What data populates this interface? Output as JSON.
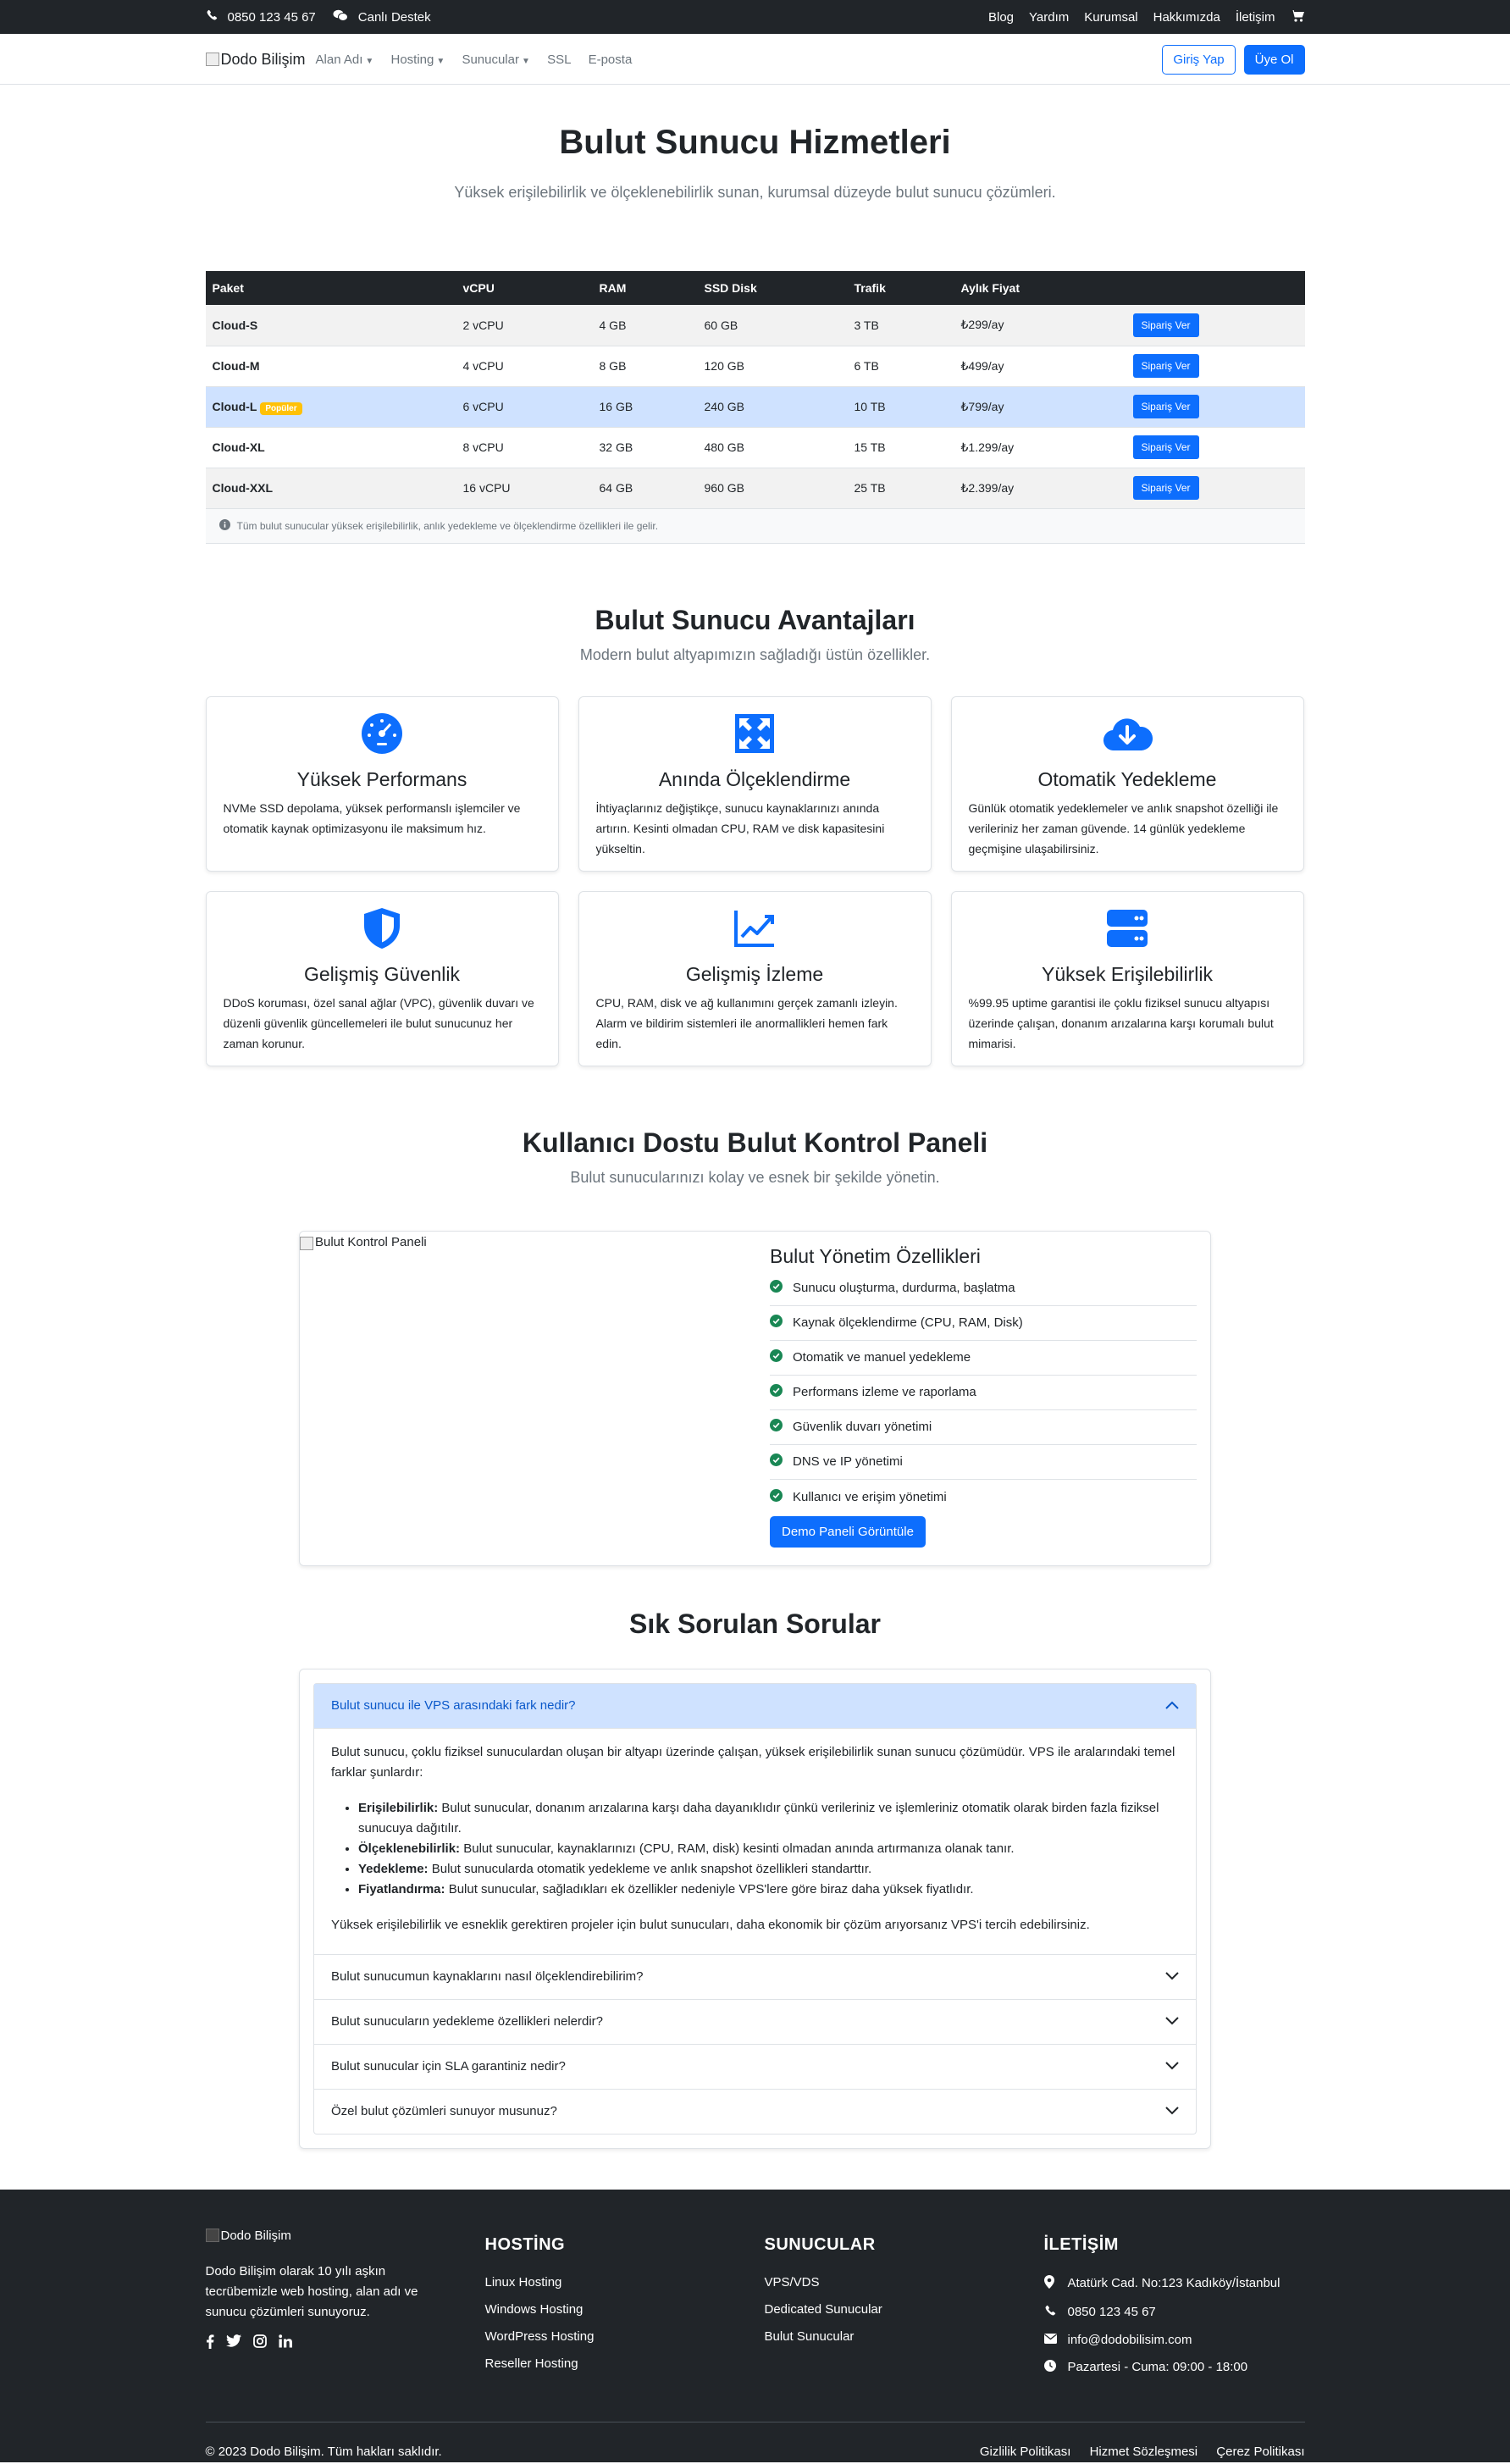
{
  "topbar": {
    "phone": "0850 123 45 67",
    "live_support": "Canlı Destek",
    "links": [
      "Blog",
      "Yardım",
      "Kurumsal",
      "Hakkımızda",
      "İletişim"
    ]
  },
  "navbar": {
    "brand": "Dodo Bilişim",
    "menu": [
      {
        "label": "Alan Adı",
        "dropdown": true
      },
      {
        "label": "Hosting",
        "dropdown": true
      },
      {
        "label": "Sunucular",
        "dropdown": true
      },
      {
        "label": "SSL",
        "dropdown": false
      },
      {
        "label": "E-posta",
        "dropdown": false
      }
    ],
    "login": "Giriş Yap",
    "signup": "Üye Ol"
  },
  "hero": {
    "title": "Bulut Sunucu Hizmetleri",
    "subtitle": "Yüksek erişilebilirlik ve ölçeklenebilirlik sunan, kurumsal düzeyde bulut sunucu çözümleri."
  },
  "pricing": {
    "headers": [
      "Paket",
      "vCPU",
      "RAM",
      "SSD Disk",
      "Trafik",
      "Aylık Fiyat",
      ""
    ],
    "order_label": "Sipariş Ver",
    "popular_badge": "Popüler",
    "rows": [
      {
        "name": "Cloud-S",
        "vcpu": "2 vCPU",
        "ram": "4 GB",
        "disk": "60 GB",
        "traffic": "3 TB",
        "price": "₺299/ay"
      },
      {
        "name": "Cloud-M",
        "vcpu": "4 vCPU",
        "ram": "8 GB",
        "disk": "120 GB",
        "traffic": "6 TB",
        "price": "₺499/ay"
      },
      {
        "name": "Cloud-L",
        "vcpu": "6 vCPU",
        "ram": "16 GB",
        "disk": "240 GB",
        "traffic": "10 TB",
        "price": "₺799/ay"
      },
      {
        "name": "Cloud-XL",
        "vcpu": "8 vCPU",
        "ram": "32 GB",
        "disk": "480 GB",
        "traffic": "15 TB",
        "price": "₺1.299/ay"
      },
      {
        "name": "Cloud-XXL",
        "vcpu": "16 vCPU",
        "ram": "64 GB",
        "disk": "960 GB",
        "traffic": "25 TB",
        "price": "₺2.399/ay"
      }
    ],
    "note": "Tüm bulut sunucular yüksek erişilebilirlik, anlık yedekleme ve ölçeklendirme özellikleri ile gelir."
  },
  "advantages": {
    "title": "Bulut Sunucu Avantajları",
    "subtitle": "Modern bulut altyapımızın sağladığı üstün özellikler.",
    "cards": [
      {
        "icon": "speedometer-icon",
        "title": "Yüksek Performans",
        "text": "NVMe SSD depolama, yüksek performanslı işlemciler ve otomatik kaynak optimizasyonu ile maksimum hız."
      },
      {
        "icon": "arrows-expand-icon",
        "title": "Anında Ölçeklendirme",
        "text": "İhtiyaçlarınız değiştikçe, sunucu kaynaklarınızı anında artırın. Kesinti olmadan CPU, RAM ve disk kapasitesini yükseltin."
      },
      {
        "icon": "cloud-download-icon",
        "title": "Otomatik Yedekleme",
        "text": "Günlük otomatik yedeklemeler ve anlık snapshot özelliği ile verileriniz her zaman güvende. 14 günlük yedekleme geçmişine ulaşabilirsiniz."
      },
      {
        "icon": "shield-icon",
        "title": "Gelişmiş Güvenlik",
        "text": "DDoS koruması, özel sanal ağlar (VPC), güvenlik duvarı ve düzenli güvenlik güncellemeleri ile bulut sunucunuz her zaman korunur."
      },
      {
        "icon": "chart-line-icon",
        "title": "Gelişmiş İzleme",
        "text": "CPU, RAM, disk ve ağ kullanımını gerçek zamanlı izleyin. Alarm ve bildirim sistemleri ile anormallikleri hemen fark edin."
      },
      {
        "icon": "server-icon",
        "title": "Yüksek Erişilebilirlik",
        "text": "%99.95 uptime garantisi ile çoklu fiziksel sunucu altyapısı üzerinde çalışan, donanım arızalarına karşı korumalı bulut mimarisi."
      }
    ]
  },
  "control_panel": {
    "title": "Kullanıcı Dostu Bulut Kontrol Paneli",
    "subtitle": "Bulut sunucularınızı kolay ve esnek bir şekilde yönetin.",
    "image_alt": "Bulut Kontrol Paneli",
    "features_title": "Bulut Yönetim Özellikleri",
    "features": [
      "Sunucu oluşturma, durdurma, başlatma",
      "Kaynak ölçeklendirme (CPU, RAM, Disk)",
      "Otomatik ve manuel yedekleme",
      "Performans izleme ve raporlama",
      "Güvenlik duvarı yönetimi",
      "DNS ve IP yönetimi",
      "Kullanıcı ve erişim yönetimi"
    ],
    "demo_button": "Demo Paneli Görüntüle"
  },
  "faq": {
    "title": "Sık Sorulan Sorular",
    "open_question": "Bulut sunucu ile VPS arasındaki fark nedir?",
    "open_intro": "Bulut sunucu, çoklu fiziksel sunuculardan oluşan bir altyapı üzerinde çalışan, yüksek erişilebilirlik sunan sunucu çözümüdür. VPS ile aralarındaki temel farklar şunlardır:",
    "open_points": [
      {
        "term": "Erişilebilirlik:",
        "text": " Bulut sunucular, donanım arızalarına karşı daha dayanıklıdır çünkü verileriniz ve işlemleriniz otomatik olarak birden fazla fiziksel sunucuya dağıtılır."
      },
      {
        "term": "Ölçeklenebilirlik:",
        "text": " Bulut sunucular, kaynaklarınızı (CPU, RAM, disk) kesinti olmadan anında artırmanıza olanak tanır."
      },
      {
        "term": "Yedekleme:",
        "text": " Bulut sunucularda otomatik yedekleme ve anlık snapshot özellikleri standarttır."
      },
      {
        "term": "Fiyatlandırma:",
        "text": " Bulut sunucular, sağladıkları ek özellikler nedeniyle VPS'lere göre biraz daha yüksek fiyatlıdır."
      }
    ],
    "open_outro": "Yüksek erişilebilirlik ve esneklik gerektiren projeler için bulut sunucuları, daha ekonomik bir çözüm arıyorsanız VPS'i tercih edebilirsiniz.",
    "closed_questions": [
      "Bulut sunucumun kaynaklarını nasıl ölçeklendirebilirim?",
      "Bulut sunucuların yedekleme özellikleri nelerdir?",
      "Bulut sunucular için SLA garantiniz nedir?",
      "Özel bulut çözümleri sunuyor musunuz?"
    ]
  },
  "footer": {
    "brand": "Dodo Bilişim",
    "about": "Dodo Bilişim olarak 10 yılı aşkın tecrübemizle web hosting, alan adı ve sunucu çözümleri sunuyoruz.",
    "hosting_title": "HOSTİNG",
    "hosting_links": [
      "Linux Hosting",
      "Windows Hosting",
      "WordPress Hosting",
      "Reseller Hosting"
    ],
    "servers_title": "SUNUCULAR",
    "servers_links": [
      "VPS/VDS",
      "Dedicated Sunucular",
      "Bulut Sunucular"
    ],
    "contact_title": "İLETİŞİM",
    "address": "Atatürk Cad. No:123 Kadıköy/İstanbul",
    "phone": "0850 123 45 67",
    "email": "info@dodobilisim.com",
    "hours": "Pazartesi - Cuma: 09:00 - 18:00",
    "copyright": "© 2023 Dodo Bilişim. Tüm hakları saklıdır.",
    "legal_links": [
      "Gizlilik Politikası",
      "Hizmet Sözleşmesi",
      "Çerez Politikası"
    ]
  }
}
